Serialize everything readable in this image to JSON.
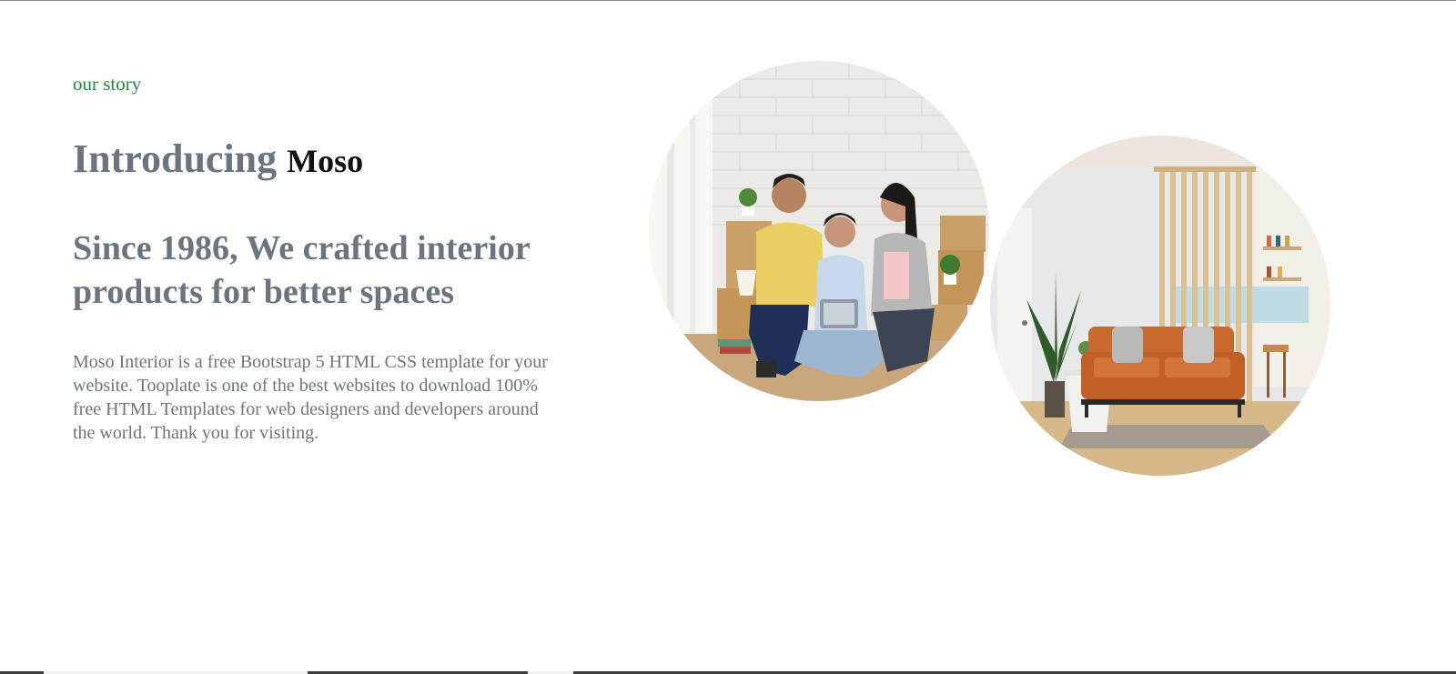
{
  "story": {
    "eyebrow": "our story",
    "title_prefix": "Introducing",
    "title_brand": "Moso",
    "tagline": "Since 1986, We crafted interior products for better spaces",
    "description": "Moso Interior is a free Bootstrap 5 HTML CSS template for your website. Tooplate is one of the best websites to download 100% free HTML Templates for web designers and developers around the world. Thank you for visiting."
  },
  "images": [
    {
      "name": "family-photo",
      "subject": "family sitting on floor with tablet among moving boxes"
    },
    {
      "name": "living-room-photo",
      "subject": "living room with orange sofa and wooden slat divider"
    }
  ],
  "colors": {
    "accent": "#1f8a3c",
    "heading": "#6c757d",
    "brand": "#111111",
    "body_text": "#6c757d"
  }
}
